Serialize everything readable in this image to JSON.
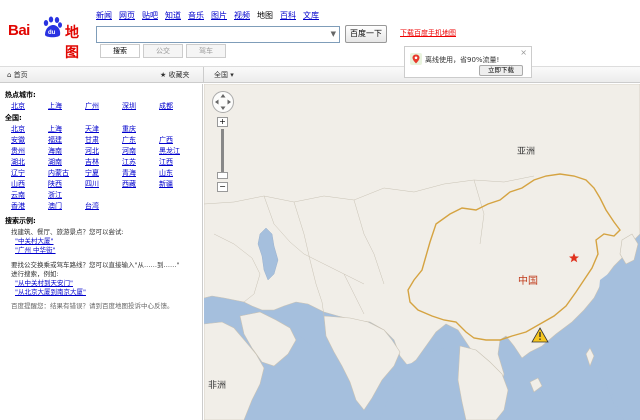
{
  "logo": {
    "text_bai": "Bai",
    "text_du": "du",
    "text_ditu": "地图"
  },
  "nav": [
    "新闻",
    "网页",
    "贴吧",
    "知道",
    "音乐",
    "图片",
    "视频",
    "地图",
    "百科",
    "文库"
  ],
  "nav_active_index": 7,
  "search": {
    "value": "",
    "dropdown_arrow": "▼",
    "button": "百度一下",
    "app_link": "下载百度手机地图"
  },
  "modes": [
    {
      "label": "搜索",
      "active": true
    },
    {
      "label": "公交",
      "active": false
    },
    {
      "label": "驾车",
      "active": false
    }
  ],
  "promo": {
    "text": "离线使用，省90%流量!",
    "button": "立即下载",
    "close": "×"
  },
  "toolbar": {
    "home": "首页",
    "favorites": "收藏夹",
    "city": "全国"
  },
  "sidebar": {
    "hot_title": "热点城市:",
    "hot_cities": [
      "北京",
      "上海",
      "广州",
      "深圳",
      "成都"
    ],
    "all_title": "全国:",
    "all_cities": [
      "北京",
      "上海",
      "天津",
      "重庆",
      "",
      "安徽",
      "福建",
      "甘肃",
      "广东",
      "广西",
      "贵州",
      "海南",
      "河北",
      "河南",
      "黑龙江",
      "湖北",
      "湖南",
      "吉林",
      "江苏",
      "江西",
      "辽宁",
      "内蒙古",
      "宁夏",
      "青海",
      "山东",
      "山西",
      "陕西",
      "四川",
      "西藏",
      "新疆",
      "云南",
      "浙江",
      "",
      "",
      "",
      "香港",
      "澳门",
      "台湾",
      "",
      ""
    ],
    "examples_title": "搜索示例:",
    "ex1": "找建筑、餐厅、旅游景点？您可以尝试:",
    "ex1_q1": "\"中关村大厦\"",
    "ex1_q2": "\"广州 中华街\"",
    "ex2": "要找公交换乘或驾车路线？您可以直接输入\"从……到……\"",
    "ex2b": "进行搜索，例如:",
    "ex2_q1": "\"从中关村到天安门\"",
    "ex2_q2": "\"从北京大厦到南京大厦\"",
    "feedback": "百度提醒您：结果有错误？请到百度地图投诉中心反馈。"
  },
  "map": {
    "labels": {
      "asia": "亚洲",
      "china": "中国",
      "africa": "非洲"
    },
    "controls": {
      "zoom_in": "+",
      "zoom_out": "−"
    },
    "colors": {
      "water": "#a5bfdd",
      "land": "#f1eee8",
      "border": "#d5a341",
      "china_label": "#c03a1a"
    }
  }
}
